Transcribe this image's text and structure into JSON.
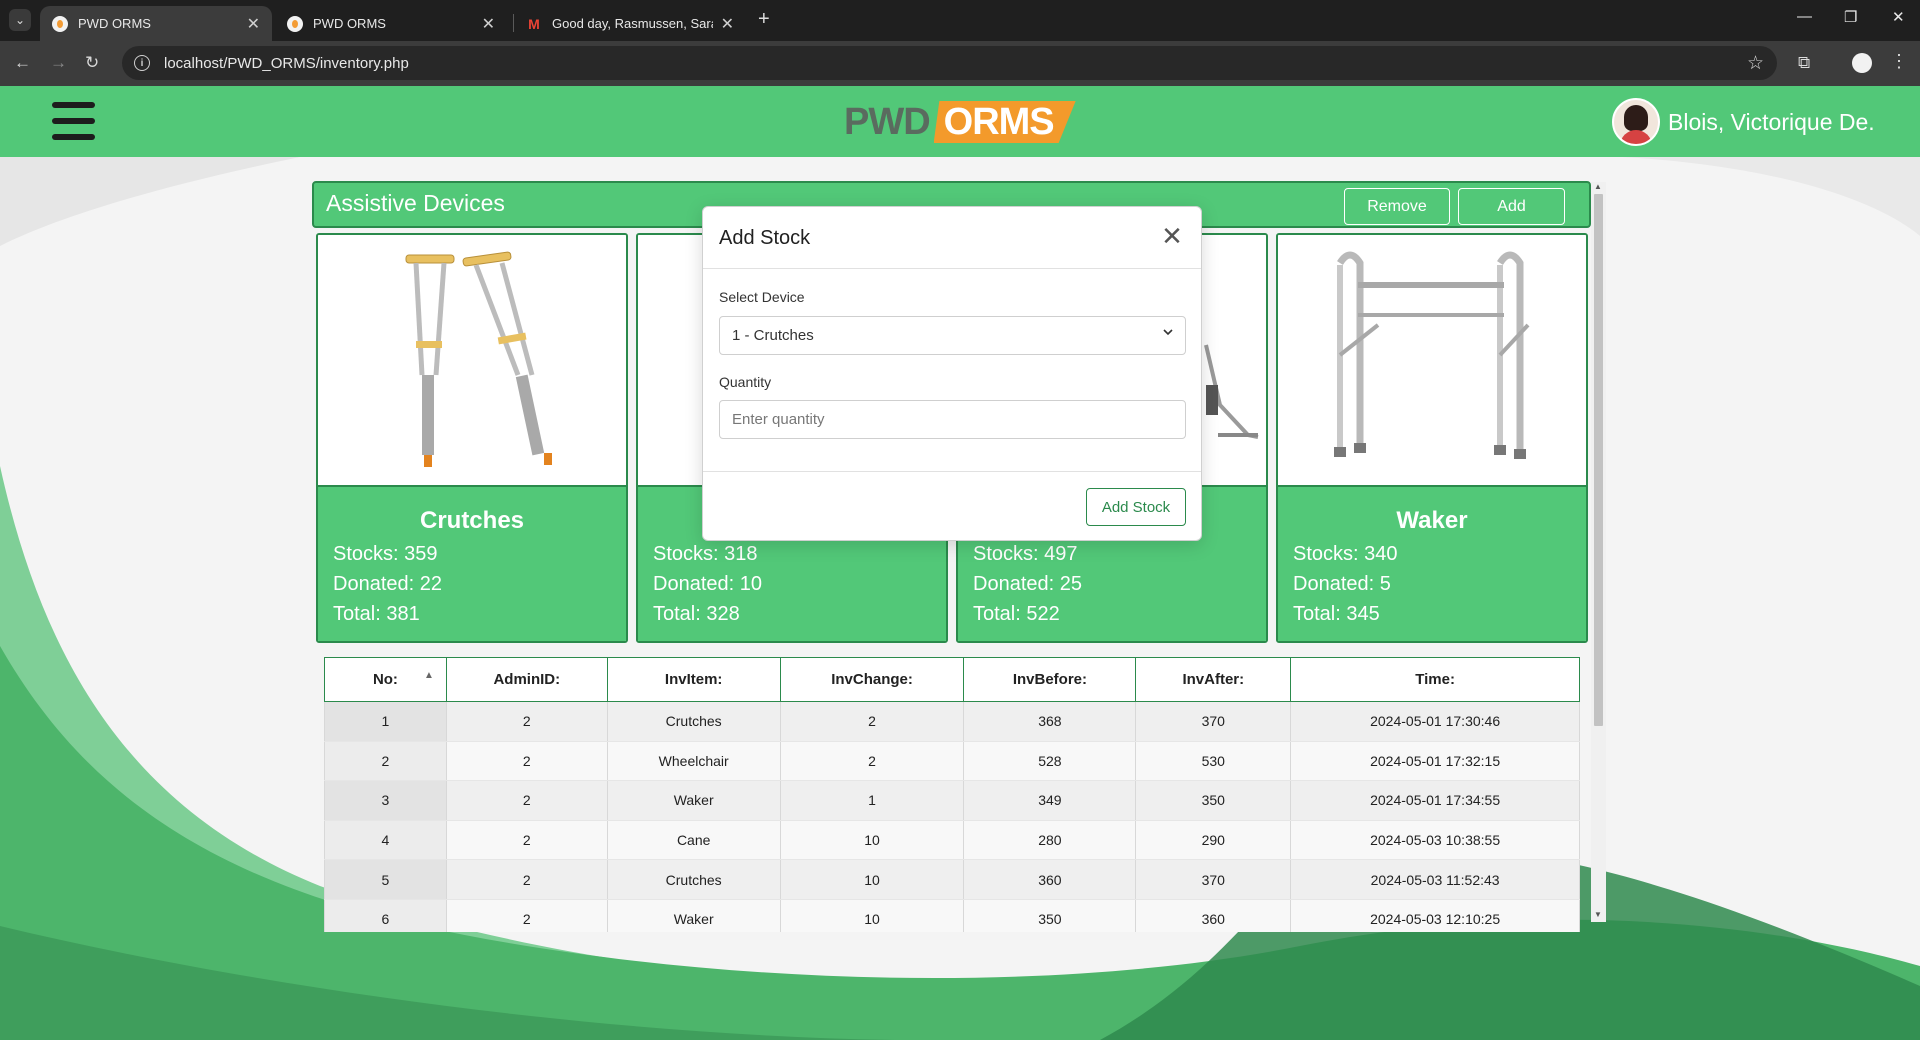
{
  "browser": {
    "tabs": [
      {
        "title": "PWD ORMS",
        "active": true
      },
      {
        "title": "PWD ORMS",
        "active": false
      },
      {
        "title": "Good day, Rasmussen, Sara Au",
        "active": false
      }
    ],
    "url": "localhost/PWD_ORMS/inventory.php"
  },
  "header": {
    "logo_left": "PWD",
    "logo_right": "ORMS",
    "user_name": "Blois, Victorique De."
  },
  "panel": {
    "title": "Assistive Devices",
    "remove_label": "Remove",
    "add_label": "Add"
  },
  "cards": [
    {
      "name": "Crutches",
      "stocks": "Stocks: 359",
      "donated": "Donated: 22",
      "total": "Total: 381"
    },
    {
      "name": "",
      "stocks": "Stocks: 318",
      "donated": "Donated: 10",
      "total": "Total: 328"
    },
    {
      "name": "",
      "stocks": "Stocks: 497",
      "donated": "Donated: 25",
      "total": "Total: 522"
    },
    {
      "name": "Waker",
      "stocks": "Stocks: 340",
      "donated": "Donated: 5",
      "total": "Total: 345"
    }
  ],
  "table": {
    "columns": [
      "No:",
      "AdminID:",
      "InvItem:",
      "InvChange:",
      "InvBefore:",
      "InvAfter:",
      "Time:"
    ],
    "rows": [
      [
        "1",
        "2",
        "Crutches",
        "2",
        "368",
        "370",
        "2024-05-01 17:30:46"
      ],
      [
        "2",
        "2",
        "Wheelchair",
        "2",
        "528",
        "530",
        "2024-05-01 17:32:15"
      ],
      [
        "3",
        "2",
        "Waker",
        "1",
        "349",
        "350",
        "2024-05-01 17:34:55"
      ],
      [
        "4",
        "2",
        "Cane",
        "10",
        "280",
        "290",
        "2024-05-03 10:38:55"
      ],
      [
        "5",
        "2",
        "Crutches",
        "10",
        "360",
        "370",
        "2024-05-03 11:52:43"
      ],
      [
        "6",
        "2",
        "Waker",
        "10",
        "350",
        "360",
        "2024-05-03 12:10:25"
      ]
    ]
  },
  "modal": {
    "title": "Add Stock",
    "select_label": "Select Device",
    "select_value": "1 - Crutches",
    "quantity_label": "Quantity",
    "quantity_placeholder": "Enter quantity",
    "submit_label": "Add Stock"
  },
  "colors": {
    "accent_green": "#52c878",
    "border_green": "#2b8a4c",
    "logo_orange": "#f39a2b"
  }
}
